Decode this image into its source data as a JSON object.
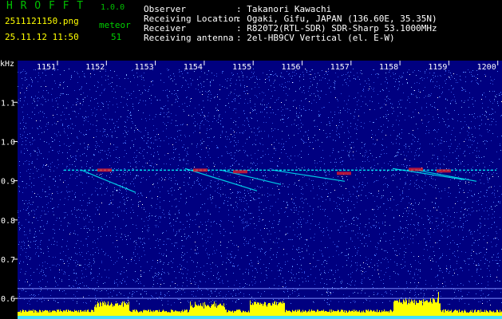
{
  "app": {
    "title": "H R O F F T",
    "version": "1.0.0"
  },
  "file": {
    "name": "2511121150.png",
    "datetime": "25.11.12 11:50"
  },
  "meteor": {
    "label": "meteor",
    "count": "51"
  },
  "info": [
    {
      "key": "Observer",
      "value": ": Takanori Kawachi"
    },
    {
      "key": "Receiving Location",
      "value": ": Ogaki, Gifu, JAPAN (136.60E, 35.35N)"
    },
    {
      "key": "Receiver",
      "value": ": R820T2(RTL-SDR) SDR-Sharp 53.1000MHz"
    },
    {
      "key": "Receiving antenna",
      "value": ": 2el-HB9CV Vertical (el. E-W)"
    }
  ],
  "chart_data": {
    "type": "heatmap",
    "ylabel": "kHz",
    "x_ticks": [
      "1151",
      "1152",
      "1153",
      "1154",
      "1155",
      "1156",
      "1157",
      "1158",
      "1159",
      "1200"
    ],
    "y_ticks": [
      "1.1",
      "1.0",
      "0.9",
      "0.8",
      "0.7",
      "0.6"
    ],
    "ylim": [
      0.58,
      1.19
    ],
    "carrier_khz": 0.927,
    "colors": {
      "background": "#000080",
      "noise": "#4060ff",
      "signal": "#00ffff",
      "strong": "#ff2020",
      "spectrum": "#ffff00"
    }
  }
}
